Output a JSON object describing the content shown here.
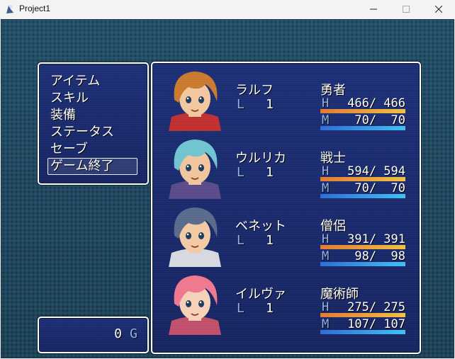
{
  "window": {
    "title": "Project1",
    "controls": {
      "minimize": "minimize-icon",
      "maximize": "maximize-icon",
      "close": "close-icon"
    }
  },
  "menu": {
    "items": [
      {
        "label": "アイテム"
      },
      {
        "label": "スキル"
      },
      {
        "label": "装備"
      },
      {
        "label": "ステータス"
      },
      {
        "label": "セーブ"
      },
      {
        "label": "ゲーム終了"
      }
    ],
    "selected_index": 5
  },
  "gold": {
    "value": "0",
    "unit": "G"
  },
  "party": [
    {
      "name": "ラルフ",
      "class": "勇者",
      "level_label": "L",
      "level": "1",
      "hp_label": "H",
      "hp": "466/ 466",
      "hp_ratio": 1.0,
      "mp_label": "M",
      "mp": " 70/  70",
      "mp_ratio": 1.0,
      "hair": "#c97a2e",
      "skin": "#f2c7a0",
      "outfit": "#c03030"
    },
    {
      "name": "ウルリカ",
      "class": "戦士",
      "level_label": "L",
      "level": "1",
      "hp_label": "H",
      "hp": "594/ 594",
      "hp_ratio": 1.0,
      "mp_label": "M",
      "mp": " 70/  70",
      "mp_ratio": 1.0,
      "hair": "#6fc4cf",
      "skin": "#f0c49c",
      "outfit": "#5a4a8a"
    },
    {
      "name": "ベネット",
      "class": "僧侶",
      "level_label": "L",
      "level": "1",
      "hp_label": "H",
      "hp": "391/ 391",
      "hp_ratio": 1.0,
      "mp_label": "M",
      "mp": " 98/  98",
      "mp_ratio": 1.0,
      "hair": "#5a6a8a",
      "skin": "#f2c9a4",
      "outfit": "#d8d8e0"
    },
    {
      "name": "イルヴァ",
      "class": "魔術師",
      "level_label": "L",
      "level": "1",
      "hp_label": "H",
      "hp": "275/ 275",
      "hp_ratio": 1.0,
      "mp_label": "M",
      "mp": "107/ 107",
      "mp_ratio": 1.0,
      "hair": "#ee7890",
      "skin": "#f6d0b8",
      "outfit": "#c0506a"
    }
  ]
}
